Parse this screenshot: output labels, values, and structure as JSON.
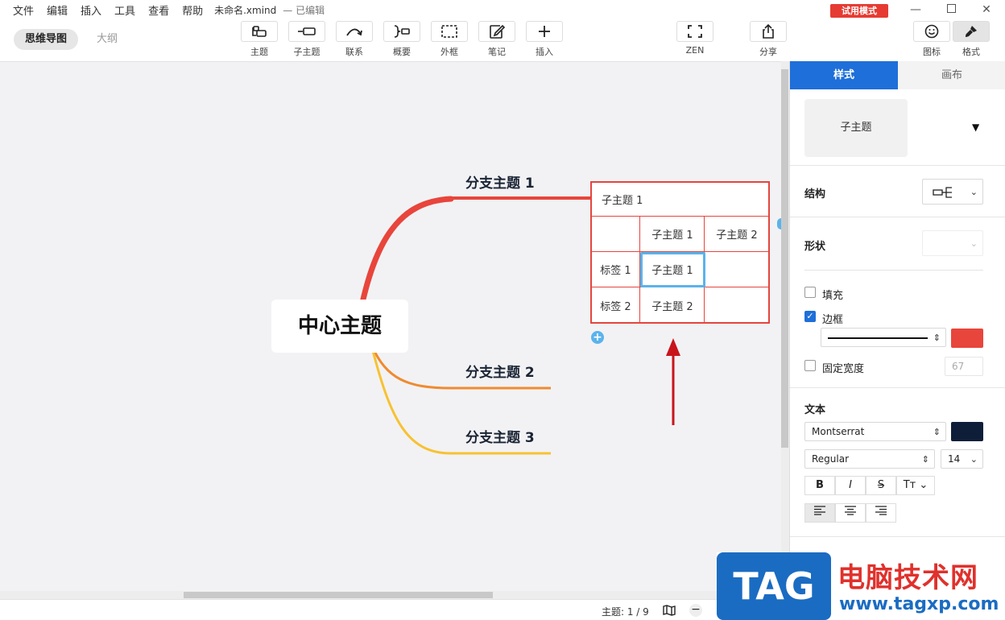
{
  "menu": [
    "文件",
    "编辑",
    "插入",
    "工具",
    "查看",
    "帮助"
  ],
  "file_title": "未命名.xmind",
  "edit_status": "— 已编辑",
  "trial_badge": "试用模式",
  "view_tabs": {
    "mindmap": "思维导图",
    "outline": "大纲"
  },
  "tools": {
    "topic": "主题",
    "subtopic": "子主题",
    "relationship": "联系",
    "summary": "概要",
    "boundary": "外框",
    "note": "笔记",
    "insert": "插入",
    "zen": "ZEN",
    "share": "分享",
    "icon": "图标",
    "format": "格式"
  },
  "map": {
    "central": "中心主题",
    "branches": [
      "分支主题 1",
      "分支主题 2",
      "分支主题 3"
    ],
    "branch_colors": [
      "#e8453c",
      "#f08a30",
      "#f7c232"
    ],
    "matrix": {
      "header": "子主题 1",
      "col_headers": [
        "子主题 1",
        "子主题 2"
      ],
      "rows": [
        {
          "label": "标签 1",
          "cells": [
            "子主题 1",
            ""
          ]
        },
        {
          "label": "标签 2",
          "cells": [
            "子主题 2",
            ""
          ]
        }
      ]
    }
  },
  "statusbar": {
    "topic_count": "主题: 1 / 9"
  },
  "panel": {
    "tabs": {
      "style": "样式",
      "canvas": "画布"
    },
    "preview": "子主题",
    "structure_label": "结构",
    "shape_label": "形状",
    "fill_label": "填充",
    "fill_checked": false,
    "border_label": "边框",
    "border_checked": true,
    "border_color": "#e8453c",
    "fixed_width_label": "固定宽度",
    "fixed_width_value": "67",
    "text_label": "文本",
    "font_family": "Montserrat",
    "font_weight": "Regular",
    "font_size": "14",
    "text_color": "#0f1e38",
    "format_buttons": {
      "bold": "B",
      "italic": "I",
      "strike": "S",
      "case": "Tт"
    }
  },
  "watermark": {
    "logo": "TAG",
    "title": "电脑技术网",
    "url": "www.tagxp.com"
  }
}
